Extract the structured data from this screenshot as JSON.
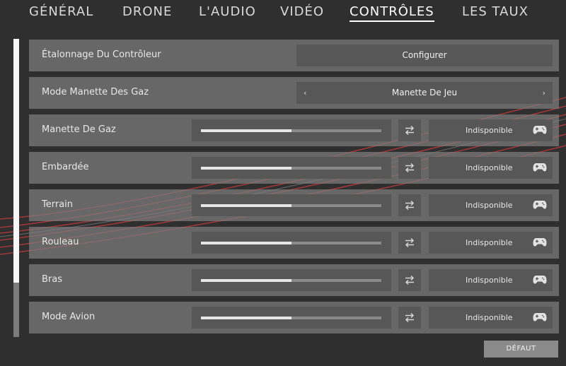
{
  "tabs": [
    {
      "label": "GÉNÉRAL",
      "active": false
    },
    {
      "label": "DRONE",
      "active": false
    },
    {
      "label": "L'AUDIO",
      "active": false
    },
    {
      "label": "VIDÉO",
      "active": false
    },
    {
      "label": "CONTRÔLES",
      "active": true
    },
    {
      "label": "LES TAUX",
      "active": false
    }
  ],
  "rows": {
    "calibration": {
      "label": "Étalonnage Du Contrôleur",
      "button": "Configurer"
    },
    "throttle_mode": {
      "label": "Mode Manette Des Gaz",
      "value": "Manette De Jeu",
      "prev": "‹",
      "next": "›"
    },
    "axes": [
      {
        "label": "Manette De Gaz",
        "level_percent": 50,
        "assignment": "Indisponible"
      },
      {
        "label": "Embardée",
        "level_percent": 50,
        "assignment": "Indisponible"
      },
      {
        "label": "Terrain",
        "level_percent": 50,
        "assignment": "Indisponible"
      },
      {
        "label": "Rouleau",
        "level_percent": 50,
        "assignment": "Indisponible"
      },
      {
        "label": "Bras",
        "level_percent": 50,
        "assignment": "Indisponible"
      },
      {
        "label": "Mode Avion",
        "level_percent": 50,
        "assignment": "Indisponible"
      }
    ]
  },
  "footer": {
    "default_label": "DÉFAUT"
  },
  "icons": {
    "swap": "swap-arrows-icon",
    "controller": "gamepad-icon"
  },
  "colors": {
    "accent_streak": "#b23a3a",
    "panel": "#7d7d7d",
    "control": "#575757"
  }
}
